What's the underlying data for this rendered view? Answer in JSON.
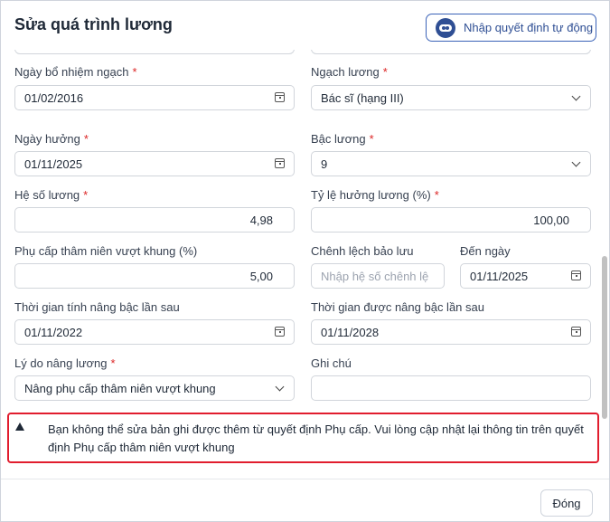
{
  "dialog": {
    "title": "Sửa quá trình lương",
    "auto_import_label": "Nhập quyết định tự động"
  },
  "form": {
    "appointment_date": {
      "label": "Ngày bổ nhiệm ngạch",
      "value": "01/02/2016"
    },
    "salary_grade": {
      "label": "Ngạch lương",
      "value": "Bác sĩ (hạng III)"
    },
    "effective_date": {
      "label": "Ngày hưởng",
      "value": "01/11/2025"
    },
    "salary_step": {
      "label": "Bậc lương",
      "value": "9"
    },
    "coefficient": {
      "label": "Hệ số lương",
      "value": "4,98"
    },
    "benefit_rate": {
      "label": "Tỷ lệ hưởng lương (%)",
      "value": "100,00"
    },
    "seniority_allowance": {
      "label": "Phụ cấp thâm niên vượt khung (%)",
      "value": "5,00"
    },
    "reserved_difference": {
      "label": "Chênh lệch bảo lưu",
      "placeholder": "Nhập hệ số chênh lệ"
    },
    "until_date": {
      "label": "Đến ngày",
      "value": "01/11/2025"
    },
    "next_raise_calc": {
      "label": "Thời gian tính nâng bậc lần sau",
      "value": "01/11/2022"
    },
    "next_raise": {
      "label": "Thời gian được nâng bậc lần sau",
      "value": "01/11/2028"
    },
    "raise_reason": {
      "label": "Lý do nâng lương",
      "value": "Nâng phụ cấp thâm niên vượt khung"
    },
    "note": {
      "label": "Ghi chú",
      "value": ""
    }
  },
  "required_mark": "*",
  "alert": {
    "message": "Bạn không thể sửa bản ghi được thêm từ quyết định Phụ cấp. Vui lòng cập nhật lại thông tin trên quyết định Phụ cấp thâm niên vượt khung"
  },
  "footer": {
    "close_label": "Đóng"
  },
  "colors": {
    "accent": "#2f4f94",
    "required": "#dc2626",
    "alert_border": "#e11d2e"
  }
}
